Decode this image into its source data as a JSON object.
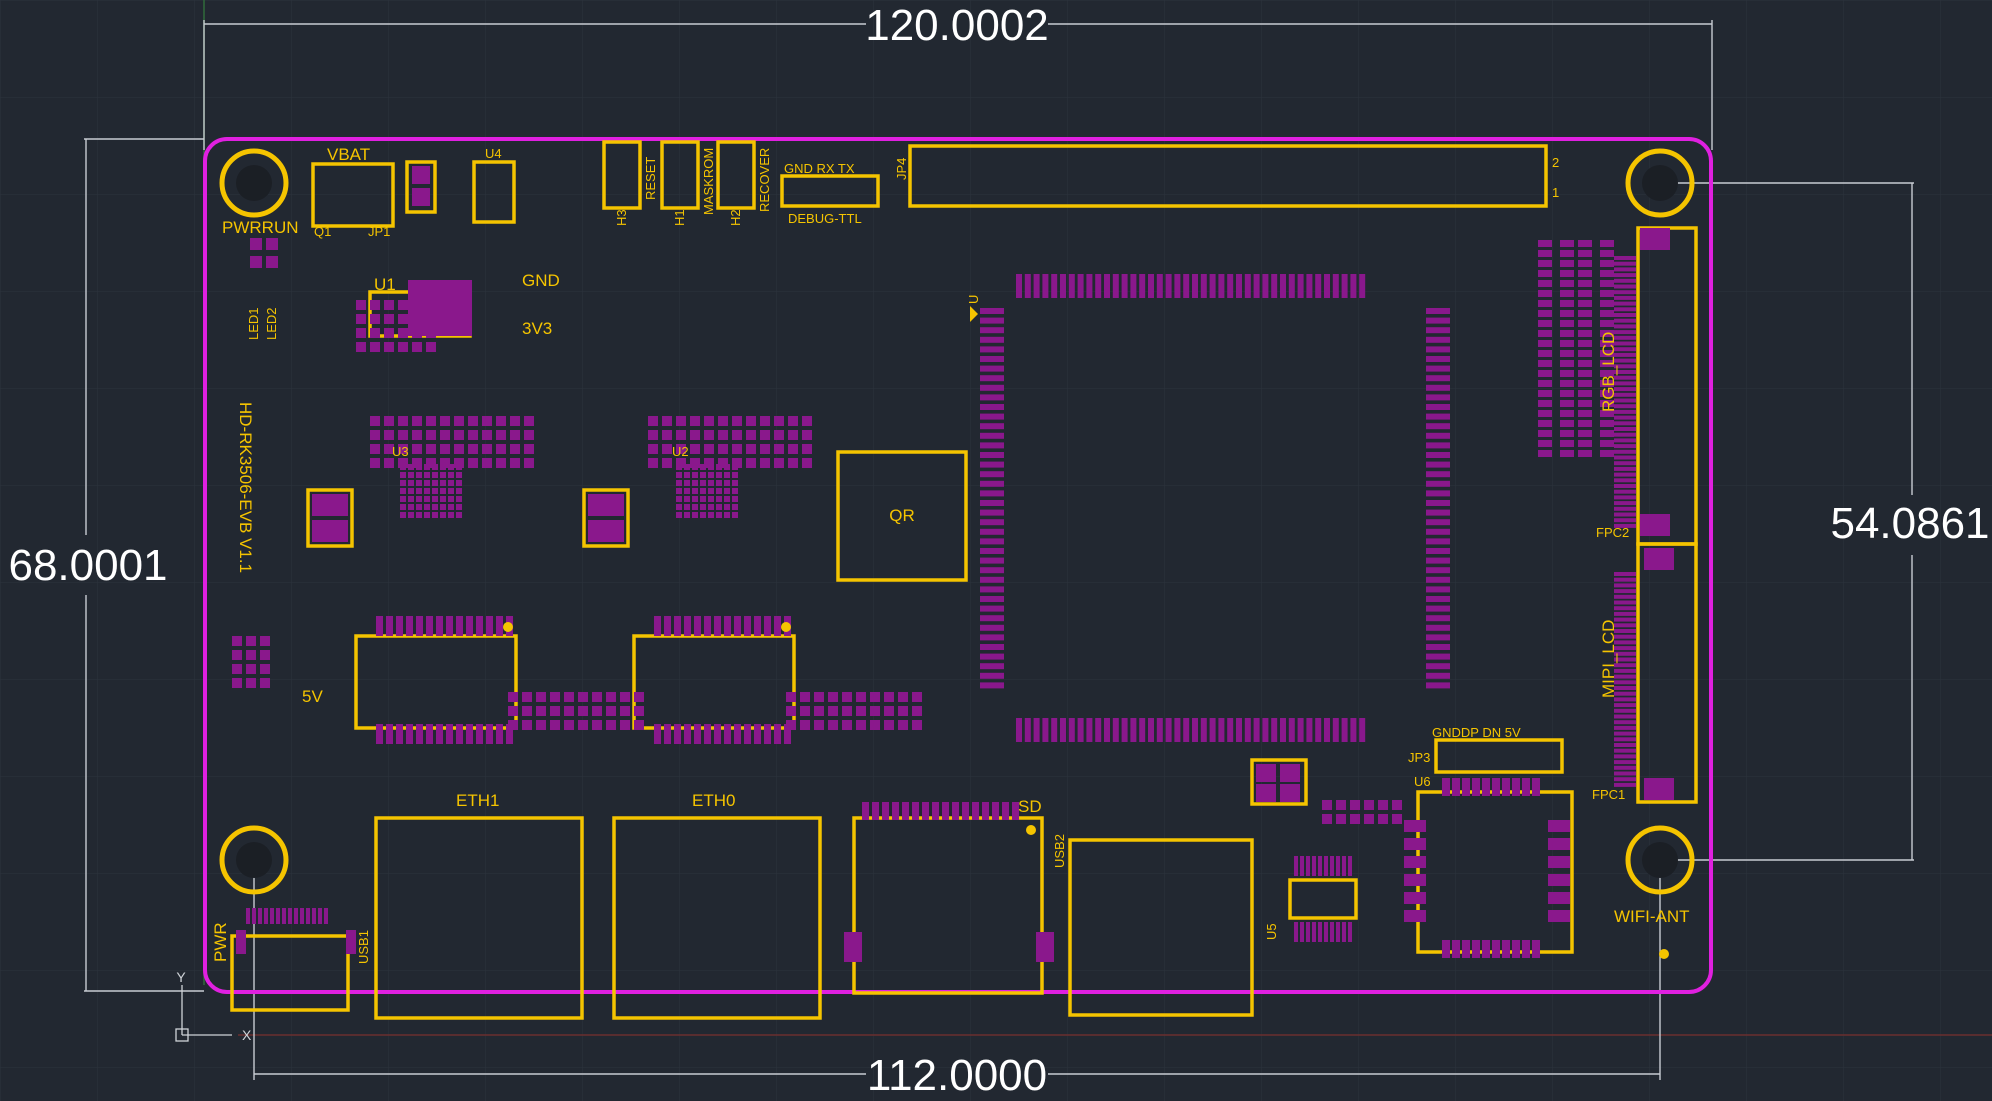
{
  "colors": {
    "background": "#222831",
    "outline": "#e020e0",
    "silkscreen": "#f5c400",
    "pad": "#8a188c",
    "dim_line": "#c8ccd2",
    "grid": "#2c333d"
  },
  "dimensions": {
    "top": "120.0002",
    "bottom": "112.0000",
    "left": "68.0001",
    "right": "54.0861"
  },
  "board_name": "HD-RK3506-EVB V1.1",
  "labels": {
    "vbat": "VBAT",
    "pwr_run": "PWRRUN",
    "q1": "Q1",
    "jp1": "JP1",
    "u4": "U4",
    "led1": "LED1",
    "led2": "LED2",
    "u1": "U1",
    "gnd": "GND",
    "v3v3": "3V3",
    "reset": "RESET",
    "maskrom": "MASKROM",
    "recover": "RECOVER",
    "h3": "H3",
    "h1": "H1",
    "h2": "H2",
    "gnd_rx_tx": "GND RX  TX",
    "debug_ttl": "DEBUG-TTL",
    "jp4": "JP4",
    "pin2": "2",
    "pin1": "1",
    "u_main": "U",
    "u3": "U3",
    "u2": "U2",
    "qr": "QR",
    "v5": "5V",
    "rgb_lcd": "RGB_LCD",
    "fpc2": "FPC2",
    "mipi_lcd": "MIPI_LCD",
    "fpc1": "FPC1",
    "jp3_pins": "GNDDP DN 5V",
    "jp3": "JP3",
    "u6": "U6",
    "u5": "U5",
    "eth1": "ETH1",
    "eth0": "ETH0",
    "sd": "SD",
    "usb2": "USB2",
    "usb1": "USB1",
    "pwr": "PWR",
    "wifi_ant": "WIFI-ANT",
    "axis_x": "X",
    "axis_y": "Y"
  }
}
